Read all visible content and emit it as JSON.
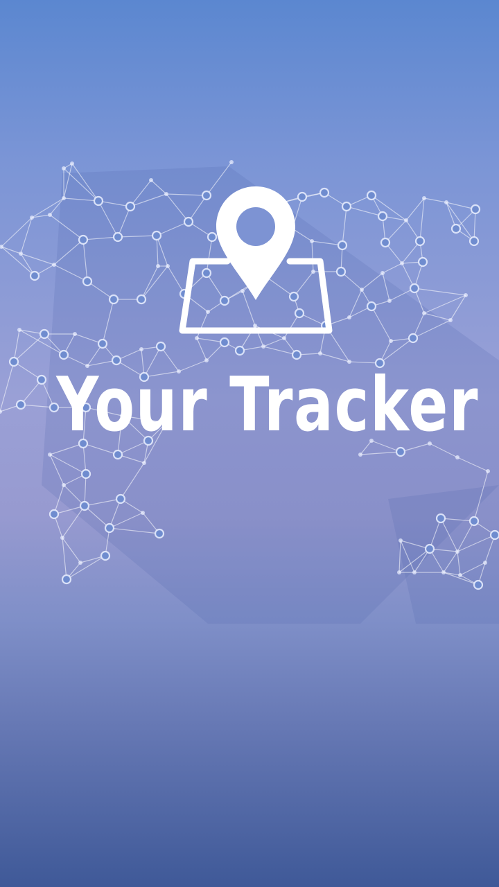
{
  "app": {
    "title": "Your Tracker"
  },
  "logo": {
    "icon": "map-pin-on-map-icon"
  },
  "background": {
    "pattern": "world-map-network-nodes",
    "gradient_top": "#5b87d0",
    "gradient_mid": "#9aa0d6",
    "gradient_bottom": "#3f5998"
  },
  "colors": {
    "title_text": "#ffffff",
    "icon": "#ffffff"
  }
}
